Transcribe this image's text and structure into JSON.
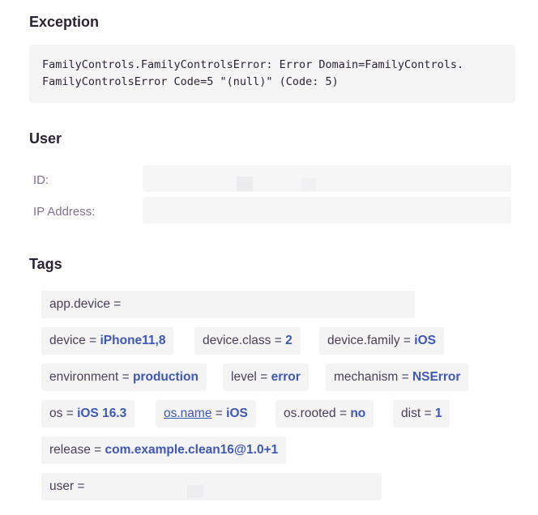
{
  "sections": {
    "exception_title": "Exception",
    "user_title": "User",
    "tags_title": "Tags"
  },
  "exception": {
    "line1": "FamilyControls.FamilyControlsError: Error Domain=FamilyControls.",
    "line2": "FamilyControlsError Code=5 \"(null)\" (Code: 5)"
  },
  "user": {
    "id_label": "ID:",
    "ip_label": "IP Address:"
  },
  "tags": {
    "equals": "=",
    "app_device": {
      "key": "app.device"
    },
    "device": {
      "key": "device",
      "value": "iPhone11,8"
    },
    "device_class": {
      "key": "device.class",
      "value": "2"
    },
    "device_family": {
      "key": "device.family",
      "value": "iOS"
    },
    "environment": {
      "key": "environment",
      "value": "production"
    },
    "level": {
      "key": "level",
      "value": "error"
    },
    "mechanism": {
      "key": "mechanism",
      "value": "NSError"
    },
    "os": {
      "key": "os",
      "value": "iOS 16.3"
    },
    "os_name": {
      "key": "os.name",
      "value": "iOS"
    },
    "os_rooted": {
      "key": "os.rooted",
      "value": "no"
    },
    "dist": {
      "key": "dist",
      "value": "1"
    },
    "release": {
      "key": "release",
      "value": "com.example.clean16@1.0+1"
    },
    "user": {
      "key": "user"
    }
  },
  "colors": {
    "tag_value": "#3f57b5",
    "label": "#80708f",
    "text": "#2b2233",
    "box_bg": "#f5f5f6"
  }
}
